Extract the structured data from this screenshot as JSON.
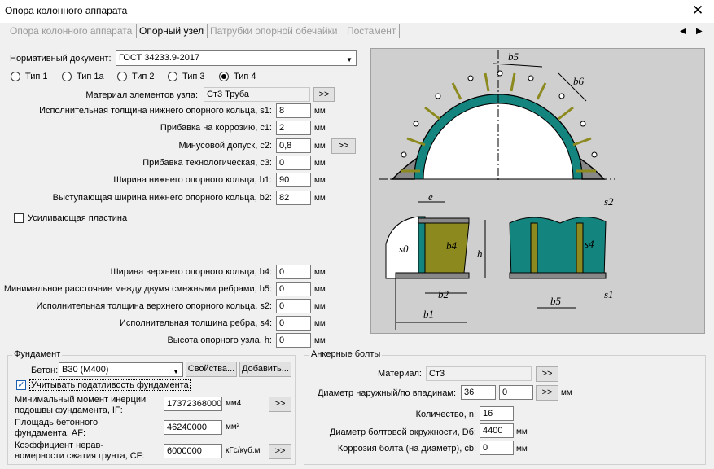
{
  "window": {
    "title": "Опора колонного аппарата",
    "close_glyph": "✕"
  },
  "tabs": [
    "Опора колонного аппарата",
    "Опорный узел",
    "Патрубки опорной обечайки",
    "Постамент"
  ],
  "tab_nav": {
    "prev": "◀",
    "next": "▶"
  },
  "doc": {
    "label": "Нормативный документ:",
    "value": "ГОСТ 34233.9-2017"
  },
  "types": [
    "Тип 1",
    "Тип 1а",
    "Тип 2",
    "Тип 3",
    "Тип 4"
  ],
  "selected_type": "Тип 4",
  "material": {
    "label": "Материал элементов узла:",
    "value": "Ст3 Труба",
    "button": ">>"
  },
  "params_top": [
    {
      "label": "Исполнительная толщина нижнего опорного кольца, s1:",
      "value": "8",
      "unit": "мм"
    },
    {
      "label": "Прибавка на коррозию, c1:",
      "value": "2",
      "unit": "мм"
    },
    {
      "label": "Минусовой допуск, c2:",
      "value": "0,8",
      "unit": "мм"
    },
    {
      "label": "Прибавка технологическая, c3:",
      "value": "0",
      "unit": "мм"
    },
    {
      "label": "Ширина нижнего опорного кольца, b1:",
      "value": "90",
      "unit": "мм"
    },
    {
      "label": "Выступающая ширина нижнего опорного кольца, b2:",
      "value": "82",
      "unit": "мм"
    }
  ],
  "c2_button": ">>",
  "plate": {
    "label": "Усиливающая пластина"
  },
  "params_bottom": [
    {
      "label": "Ширина верхнего опорного кольца, b4:",
      "value": "0",
      "unit": "мм"
    },
    {
      "label": "Минимальное расстояние между двумя смежными ребрами, b5:",
      "value": "0",
      "unit": "мм"
    },
    {
      "label": "Исполнительная толщина верхнего опорного кольца, s2:",
      "value": "0",
      "unit": "мм"
    },
    {
      "label": "Исполнительная толщина ребра, s4:",
      "value": "0",
      "unit": "мм"
    },
    {
      "label": "Высота опорного узла, h:",
      "value": "0",
      "unit": "мм"
    }
  ],
  "foundation": {
    "title": "Фундамент",
    "concrete_label": "Бетон:",
    "concrete_value": "B30 (M400)",
    "props_button": "Свойства...",
    "add_button": "Добавить...",
    "compliance_label": "Учитывать податливость фундамента",
    "inertia_label": [
      "Минимальный момент инерции",
      "подошвы фундамента, IF:"
    ],
    "inertia_value": "17372368000",
    "inertia_unit": "мм4",
    "inertia_button": ">>",
    "area_label": [
      "Площадь бетонного",
      "фундамента, AF:"
    ],
    "area_value": "46240000",
    "area_unit": "мм²",
    "coef_label": [
      "Коэффициент нерав-",
      "номерности сжатия грунта, CF:"
    ],
    "coef_value": "6000000",
    "coef_unit": "кГс/куб.м",
    "coef_button": ">>"
  },
  "anchor": {
    "title": "Анкерные болты",
    "material_label": "Материал:",
    "material_value": "Ст3",
    "material_button": ">>",
    "diameter_label": "Диаметр наружный/по впадинам:",
    "diameter_outer": "36",
    "diameter_inner": "0",
    "diameter_button": ">>",
    "diameter_unit": "мм",
    "count_label": "Количество, n:",
    "count_value": "16",
    "circle_label": "Диаметр болтовой окружности, Dб:",
    "circle_value": "4400",
    "circle_unit": "мм",
    "corrosion_label": "Коррозия болта (на диаметр), cb:",
    "corrosion_value": "0",
    "corrosion_unit": "мм"
  },
  "figure": {
    "labels": {
      "b5": "b5",
      "b6": "b6",
      "e": "e",
      "s0": "s0",
      "b4": "b4",
      "h": "h",
      "b2": "b2",
      "b1": "b1",
      "s2": "s2",
      "s4": "s4",
      "b5b": "b5",
      "s1": "s1"
    },
    "colors": {
      "bg": "#cfcfcf",
      "teal": "#14857e",
      "olive": "#8c8a1f",
      "gray": "#888888"
    }
  }
}
